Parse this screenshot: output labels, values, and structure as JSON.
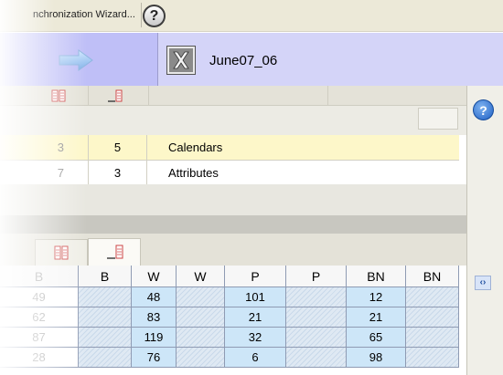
{
  "toolbar": {
    "wizard_label": "nchronization Wizard...",
    "help_glyph": "?"
  },
  "header": {
    "file_title": "June07_06",
    "file_icon": "excel-icon",
    "nav_icon": "arrow-right-icon"
  },
  "upper_table": {
    "rows": [
      {
        "left": "3",
        "count": "5",
        "name": "Calendars"
      },
      {
        "left": "7",
        "count": "3",
        "name": "Attributes"
      }
    ]
  },
  "side_panel": {
    "help_glyph": "?",
    "toggle_glyph": "‹›"
  },
  "grid": {
    "headers": [
      "B",
      "B",
      "W",
      "W",
      "P",
      "P",
      "BN",
      "BN"
    ],
    "rows": [
      {
        "b": "49",
        "w": "48",
        "p": "101",
        "bn": "12"
      },
      {
        "b": "62",
        "w": "83",
        "p": "21",
        "bn": "21"
      },
      {
        "b": "87",
        "w": "119",
        "p": "32",
        "bn": "65"
      },
      {
        "b": "28",
        "w": "76",
        "p": "6",
        "bn": "98"
      }
    ]
  },
  "colors": {
    "header_lavender": "#bfbff7",
    "selected_row": "#fdf7c9",
    "grid_blue": "#cde6f8"
  }
}
